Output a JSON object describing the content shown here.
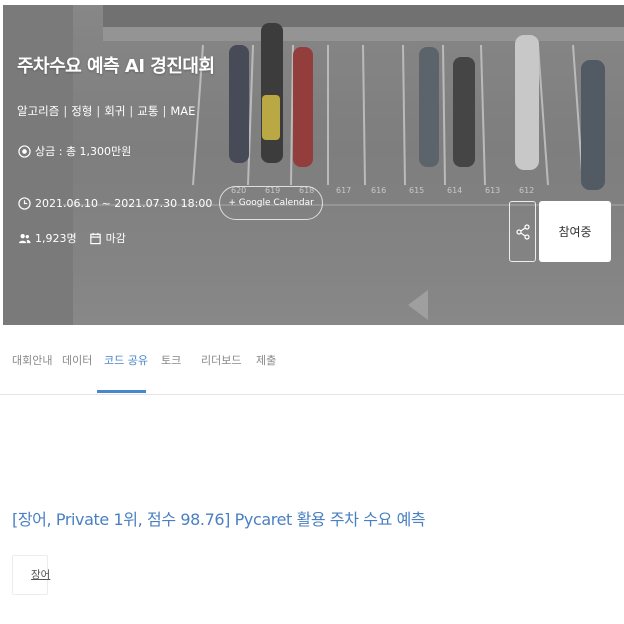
{
  "hero": {
    "title": "주차수요 예측 AI 경진대회",
    "tags": [
      "알고리즘",
      "정형",
      "회귀",
      "교통",
      "MAE"
    ],
    "prize": "상금 : 총 1,300만원",
    "period": "2021.06.10 ~ 2021.07.30 18:00",
    "calendar_label": "+ Google Calendar",
    "participants": "1,923명",
    "status": "마감",
    "join_label": "참여중",
    "parking_numbers": [
      "620",
      "619",
      "618",
      "617",
      "616",
      "615",
      "614",
      "613",
      "612"
    ]
  },
  "tabs": [
    {
      "label": "대회안내"
    },
    {
      "label": "데이터"
    },
    {
      "label": "코드 공유"
    },
    {
      "label": "토크"
    },
    {
      "label": "리더보드"
    },
    {
      "label": "제출"
    }
  ],
  "active_tab": "코드 공유",
  "post": {
    "title": "[장어, Private 1위, 점수 98.76] Pycaret 활용 주차 수요 예측",
    "author": "장어"
  }
}
